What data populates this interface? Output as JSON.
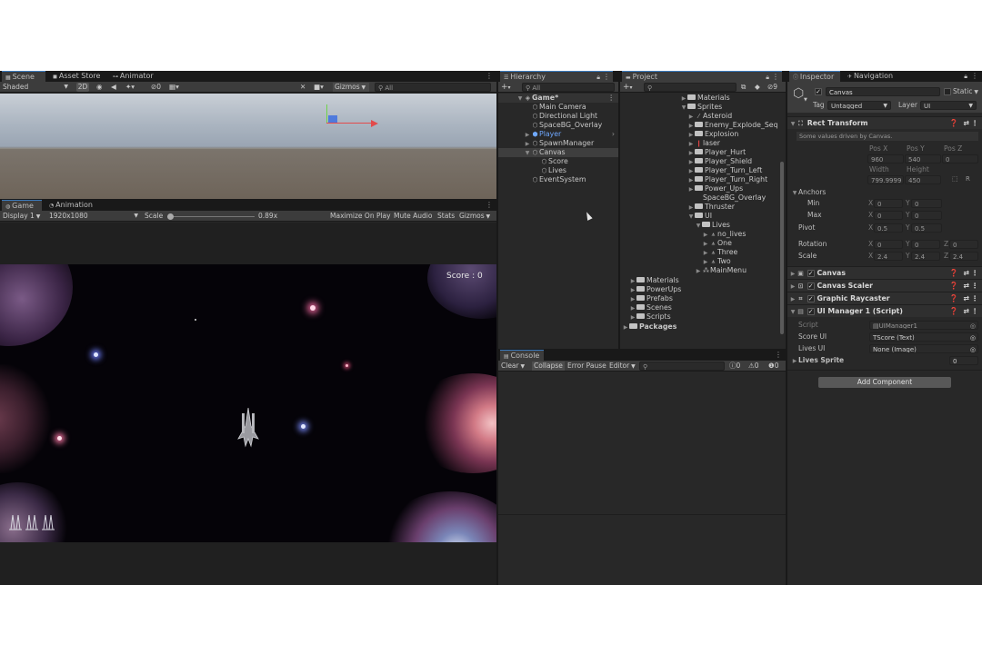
{
  "scene_panel": {
    "tabs": [
      {
        "label": "Scene"
      },
      {
        "label": "Asset Store"
      },
      {
        "label": "Animator"
      }
    ],
    "toolbar": {
      "shading": "Shaded",
      "mode_2d": "2D",
      "hidden_count": "0",
      "gizmos": "Gizmos",
      "search_placeholder": "All"
    }
  },
  "game_panel": {
    "tabs": [
      {
        "label": "Game"
      },
      {
        "label": "Animation"
      }
    ],
    "toolbar": {
      "display": "Display 1",
      "resolution": "1920x1080",
      "scale_label": "Scale",
      "scale_value": "0.89x",
      "maximize": "Maximize On Play",
      "mute": "Mute Audio",
      "stats": "Stats",
      "gizmos": "Gizmos"
    },
    "score_text": "Score : 0"
  },
  "hierarchy": {
    "tab": "Hierarchy",
    "search_placeholder": "All",
    "items": [
      {
        "label": "Game*",
        "bold": true
      },
      {
        "label": "Main Camera"
      },
      {
        "label": "Directional Light"
      },
      {
        "label": "SpaceBG_Overlay"
      },
      {
        "label": "Player",
        "prefab": true
      },
      {
        "label": "SpawnManager"
      },
      {
        "label": "Canvas",
        "selected": true
      },
      {
        "label": "Score"
      },
      {
        "label": "Lives"
      },
      {
        "label": "EventSystem"
      }
    ]
  },
  "project": {
    "tab": "Project",
    "hidden_count": "9",
    "items": [
      {
        "label": "Materials"
      },
      {
        "label": "Sprites"
      },
      {
        "label": "Asteroid"
      },
      {
        "label": "Enemy_Explode_Seque"
      },
      {
        "label": "Explosion"
      },
      {
        "label": "laser"
      },
      {
        "label": "Player_Hurt"
      },
      {
        "label": "Player_Shield"
      },
      {
        "label": "Player_Turn_Left"
      },
      {
        "label": "Player_Turn_Right"
      },
      {
        "label": "Power_Ups"
      },
      {
        "label": "SpaceBG_Overlay"
      },
      {
        "label": "Thruster"
      },
      {
        "label": "UI"
      },
      {
        "label": "Lives"
      },
      {
        "label": "no_lives"
      },
      {
        "label": "One"
      },
      {
        "label": "Three"
      },
      {
        "label": "Two"
      },
      {
        "label": "MainMenu"
      },
      {
        "label": "Materials"
      },
      {
        "label": "PowerUps"
      },
      {
        "label": "Prefabs"
      },
      {
        "label": "Scenes"
      },
      {
        "label": "Scripts"
      },
      {
        "label": "Packages"
      }
    ]
  },
  "console": {
    "tab": "Console",
    "buttons": {
      "clear": "Clear",
      "collapse": "Collapse",
      "error_pause": "Error Pause",
      "editor": "Editor"
    },
    "counts": {
      "logs": "0",
      "warnings": "0",
      "errors": "0"
    }
  },
  "inspector": {
    "tabs": [
      {
        "label": "Inspector"
      },
      {
        "label": "Navigation"
      }
    ],
    "object_name": "Canvas",
    "static_label": "Static",
    "tag_label": "Tag",
    "tag_value": "Untagged",
    "layer_label": "Layer",
    "layer_value": "UI",
    "rect_transform": {
      "title": "Rect Transform",
      "note": "Some values driven by Canvas.",
      "pos_x_label": "Pos X",
      "pos_y_label": "Pos Y",
      "pos_z_label": "Pos Z",
      "pos_x": "960",
      "pos_y": "540",
      "pos_z": "0",
      "width_label": "Width",
      "height_label": "Height",
      "width": "799.9999",
      "height": "450",
      "r_label": "R",
      "anchors_label": "Anchors",
      "min_label": "Min",
      "max_label": "Max",
      "min_x": "0",
      "min_y": "0",
      "max_x": "0",
      "max_y": "0",
      "pivot_label": "Pivot",
      "pivot_x": "0.5",
      "pivot_y": "0.5",
      "rotation_label": "Rotation",
      "rot_x": "0",
      "rot_y": "0",
      "rot_z": "0",
      "scale_label": "Scale",
      "scale_x": "2.4",
      "scale_y": "2.4",
      "scale_z": "2.4",
      "x_axis": "X",
      "y_axis": "Y",
      "z_axis": "Z"
    },
    "components": [
      {
        "label": "Canvas"
      },
      {
        "label": "Canvas Scaler"
      },
      {
        "label": "Graphic Raycaster"
      },
      {
        "label": "UI Manager 1 (Script)"
      }
    ],
    "script_fields": {
      "script_label": "Script",
      "script_value": "UIManager1",
      "score_label": "Score UI",
      "score_value": "Score (Text)",
      "lives_label": "Lives UI",
      "lives_value": "None (Image)",
      "lives_sprite_label": "Lives Sprite",
      "lives_sprite_value": "0"
    },
    "add_component": "Add Component"
  }
}
